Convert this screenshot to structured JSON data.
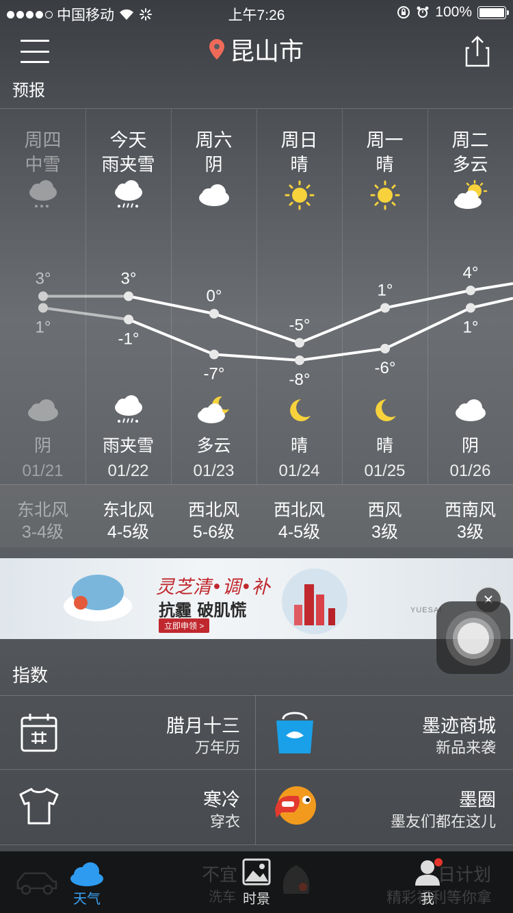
{
  "status_bar": {
    "carrier": "中国移动",
    "time": "上午7:26",
    "battery": "100%"
  },
  "nav": {
    "city": "昆山市"
  },
  "forecast_title": "预报",
  "days": [
    {
      "name": "周四",
      "cond": "中雪",
      "night_cond": "阴",
      "date": "01/21",
      "wind_dir": "东北风",
      "wind_lvl": "3-4级",
      "high": "3°",
      "low": "1°",
      "day_icon": "snow-icon",
      "night_icon": "cloud-icon"
    },
    {
      "name": "今天",
      "cond": "雨夹雪",
      "night_cond": "雨夹雪",
      "date": "01/22",
      "wind_dir": "东北风",
      "wind_lvl": "4-5级",
      "high": "3°",
      "low": "-1°",
      "day_icon": "sleet-icon",
      "night_icon": "sleet-icon"
    },
    {
      "name": "周六",
      "cond": "阴",
      "night_cond": "多云",
      "date": "01/23",
      "wind_dir": "西北风",
      "wind_lvl": "5-6级",
      "high": "0°",
      "low": "-7°",
      "day_icon": "cloud-icon",
      "night_icon": "moon-cloud-icon"
    },
    {
      "name": "周日",
      "cond": "晴",
      "night_cond": "晴",
      "date": "01/24",
      "wind_dir": "西北风",
      "wind_lvl": "4-5级",
      "high": "-5°",
      "low": "-8°",
      "day_icon": "sun-icon",
      "night_icon": "moon-icon"
    },
    {
      "name": "周一",
      "cond": "晴",
      "night_cond": "晴",
      "date": "01/25",
      "wind_dir": "西风",
      "wind_lvl": "3级",
      "high": "1°",
      "low": "-6°",
      "day_icon": "sun-icon",
      "night_icon": "moon-icon"
    },
    {
      "name": "周二",
      "cond": "多云",
      "night_cond": "阴",
      "date": "01/26",
      "wind_dir": "西南风",
      "wind_lvl": "3级",
      "high": "4°",
      "low": "1°",
      "day_icon": "sun-cloud-icon",
      "night_icon": "cloud-icon"
    }
  ],
  "temps": {
    "high": [
      3,
      3,
      0,
      -5,
      1,
      4
    ],
    "low": [
      1,
      -1,
      -7,
      -8,
      -6,
      1
    ]
  },
  "ad": {
    "line1": "灵芝清•调•补",
    "line2": "抗霾 破肌慌",
    "cta": "立即申领 >",
    "brand": "YUESAI"
  },
  "index": {
    "title": "指数",
    "cells": [
      {
        "title": "腊月十三",
        "sub": "万年历",
        "icon": "calendar-icon"
      },
      {
        "title": "墨迹商城",
        "sub": "新品来袭",
        "icon": "shopping-bag-icon"
      },
      {
        "title": "寒冷",
        "sub": "穿衣",
        "icon": "tshirt-icon"
      },
      {
        "title": "墨圈",
        "sub": "墨友们都在这儿",
        "icon": "chat-bubble-icon"
      }
    ]
  },
  "tabbar": {
    "weather": "天气",
    "scenery": "时景",
    "me": "我",
    "faded1": "不宜",
    "faded2": "洗车",
    "faded3": "日计划",
    "faded4": "精彩福利等你拿"
  }
}
